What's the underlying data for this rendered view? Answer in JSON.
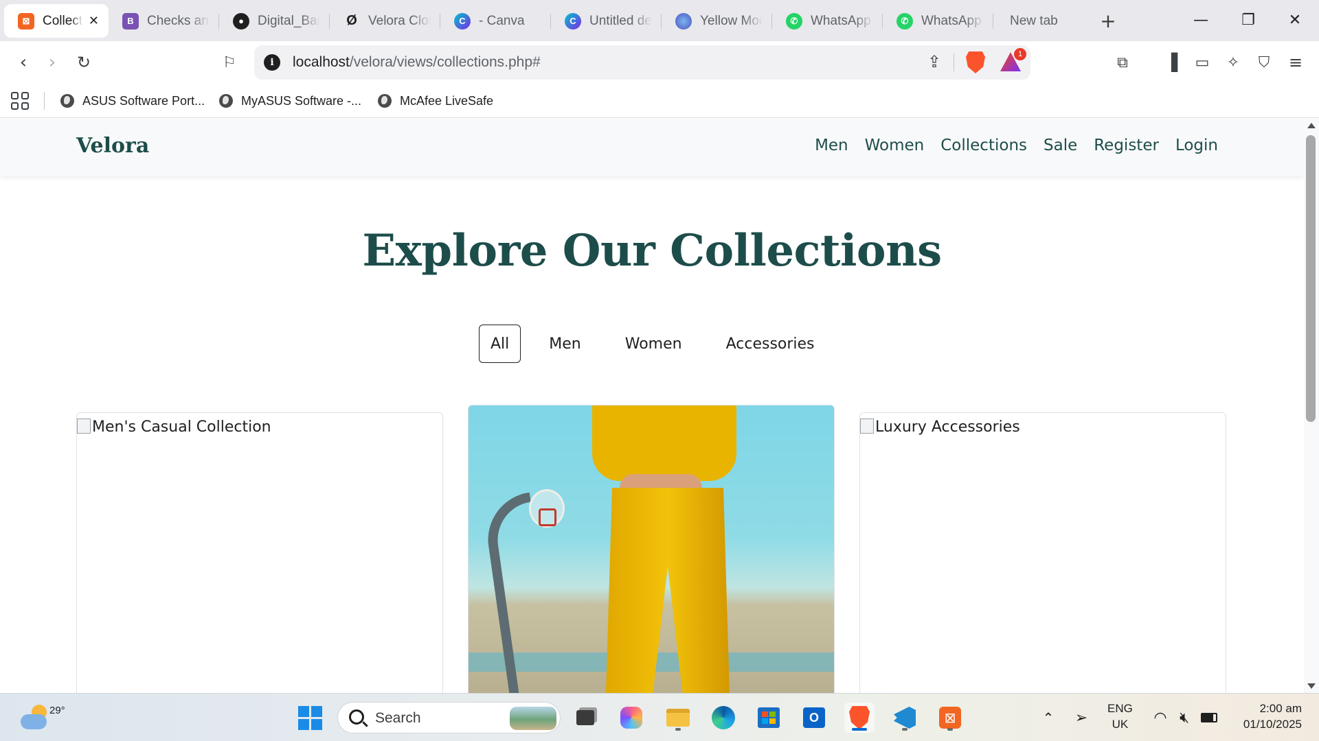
{
  "browser": {
    "tabs": [
      {
        "title": "Collections",
        "active": true,
        "favicon": "xampp-icon",
        "color": "#f26522"
      },
      {
        "title": "Checks and radios",
        "active": false,
        "favicon": "bootstrap-icon",
        "color": "#7952b3"
      },
      {
        "title": "Digital_Banking",
        "active": false,
        "favicon": "github-icon",
        "color": "#1f1f1f"
      },
      {
        "title": "Velora Clothing",
        "active": false,
        "favicon": "velora-logo-icon",
        "color": "#1f1f1f"
      },
      {
        "title": "- Canva",
        "active": false,
        "favicon": "canva-icon",
        "color": "#00c4cc"
      },
      {
        "title": "Untitled design",
        "active": false,
        "favicon": "canva-icon",
        "color": "#00c4cc"
      },
      {
        "title": "Yellow Modern",
        "active": false,
        "favicon": "image-icon",
        "color": "#6a5acd"
      },
      {
        "title": "WhatsApp",
        "active": false,
        "favicon": "whatsapp-icon",
        "color": "#25d366"
      },
      {
        "title": "WhatsApp",
        "active": false,
        "favicon": "whatsapp-icon",
        "color": "#25d366"
      },
      {
        "title": "New tab",
        "active": false,
        "favicon": "",
        "color": ""
      }
    ],
    "url_host": "localhost",
    "url_path": "/velora/views/collections.php#",
    "rewards_badge": "1",
    "bookmarks": [
      {
        "label": "ASUS Software Port..."
      },
      {
        "label": "MyASUS Software -..."
      },
      {
        "label": "McAfee LiveSafe"
      }
    ]
  },
  "site": {
    "brand": "Velora",
    "nav": [
      "Men",
      "Women",
      "Collections",
      "Sale",
      "Register",
      "Login"
    ],
    "title": "Explore Our Collections",
    "filters": [
      {
        "label": "All",
        "active": true
      },
      {
        "label": "Men",
        "active": false
      },
      {
        "label": "Women",
        "active": false
      },
      {
        "label": "Accessories",
        "active": false
      }
    ],
    "cards": [
      {
        "alt": "Men's Casual Collection",
        "image_loaded": false
      },
      {
        "alt": "",
        "image_loaded": true
      },
      {
        "alt": "Luxury Accessories",
        "image_loaded": false
      }
    ],
    "brand_color": "#1d4d4a"
  },
  "taskbar": {
    "weather_temp": "29°",
    "search_label": "Search",
    "lang_line1": "ENG",
    "lang_line2": "UK",
    "time": "2:00 am",
    "date": "01/10/2025"
  }
}
